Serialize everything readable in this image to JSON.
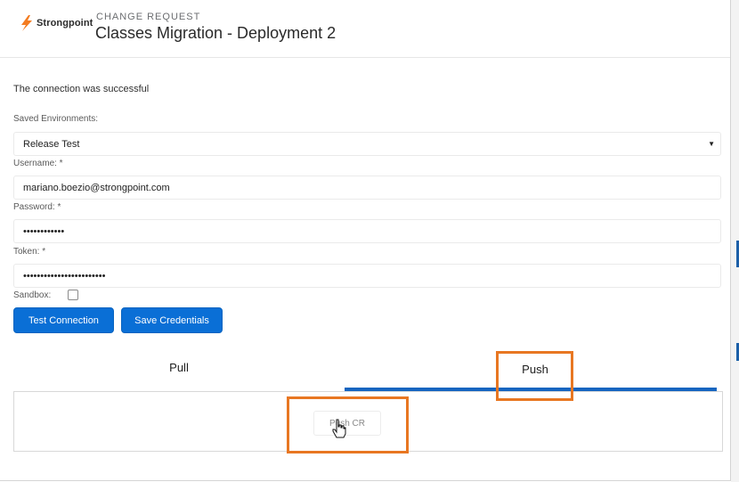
{
  "header": {
    "logo_text": "Strongpoint",
    "eyebrow": "CHANGE REQUEST",
    "title": "Classes Migration - Deployment 2"
  },
  "status_message": "The connection was successful",
  "form": {
    "saved_env_label": "Saved Environments:",
    "saved_env_value": "Release Test",
    "username_label": "Username: *",
    "username_value": "mariano.boezio@strongpoint.com",
    "password_label": "Password: *",
    "password_value": "••••••••••••",
    "token_label": "Token: *",
    "token_value": "••••••••••••••••••••••••",
    "sandbox_label": "Sandbox:"
  },
  "buttons": {
    "test_connection": "Test Connection",
    "save_credentials": "Save Credentials"
  },
  "tabs": [
    {
      "label": "Pull",
      "active": false
    },
    {
      "label": "Push",
      "active": true
    }
  ],
  "panel": {
    "push_cr_label": "Push CR"
  },
  "colors": {
    "primary": "#0a6fd6",
    "tab_underline": "#1565c0",
    "highlight": "#e87722",
    "logo_orange": "#f47c20"
  },
  "icons": [
    "strongpoint-logo-icon",
    "dropdown-caret-icon",
    "hand-cursor-icon"
  ]
}
